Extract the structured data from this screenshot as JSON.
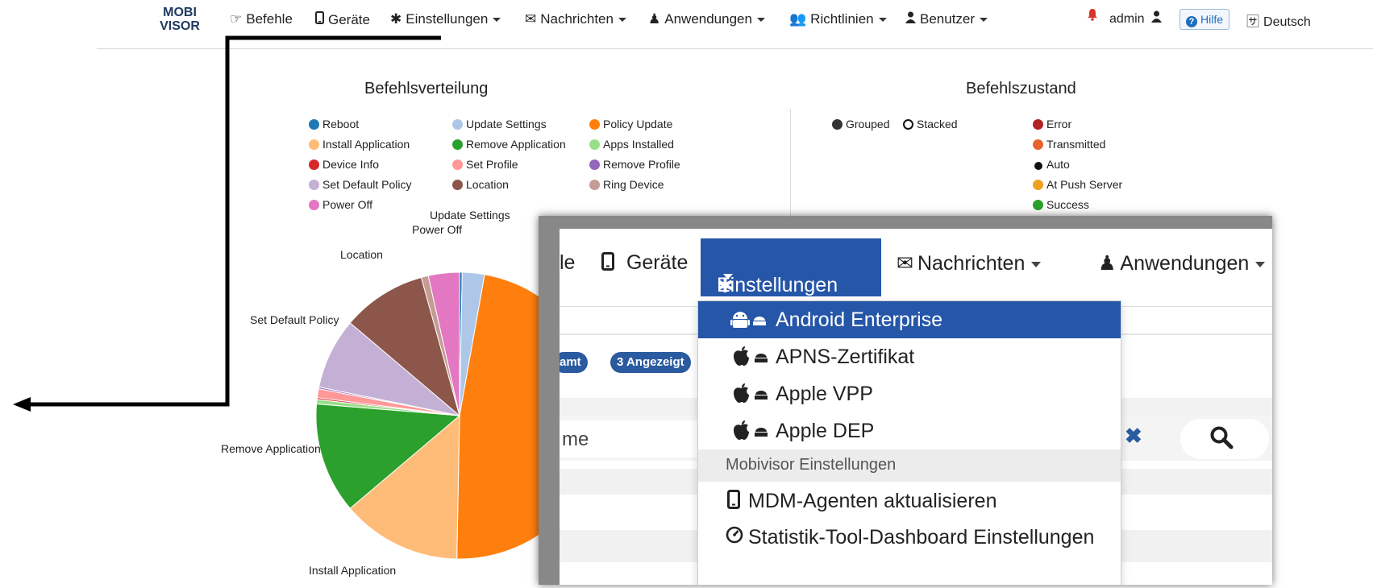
{
  "brand": {
    "line1": "MOBI",
    "line2": "VISOR"
  },
  "nav": {
    "items": [
      {
        "label": "Befehle",
        "icon": "hand-pointer-icon"
      },
      {
        "label": "Geräte",
        "icon": "mobile-icon"
      },
      {
        "label": "Einstellungen",
        "icon": "gear-icon"
      },
      {
        "label": "Nachrichten",
        "icon": "envelope-icon"
      },
      {
        "label": "Anwendungen",
        "icon": "apps-icon"
      },
      {
        "label": "Richtlinien",
        "icon": "users-icon"
      },
      {
        "label": "Benutzer",
        "icon": "user-icon"
      }
    ],
    "user": "admin",
    "help": "Hilfe",
    "language": "Deutsch"
  },
  "left_panel": {
    "title": "Befehlsverteilung",
    "legend": [
      {
        "label": "Reboot",
        "color": "#1f77b4"
      },
      {
        "label": "Update Settings",
        "color": "#aec7e8"
      },
      {
        "label": "Policy Update",
        "color": "#ff7f0e"
      },
      {
        "label": "Install Application",
        "color": "#ffbb78"
      },
      {
        "label": "Remove Application",
        "color": "#2ca02c"
      },
      {
        "label": "Apps Installed",
        "color": "#98df8a"
      },
      {
        "label": "Device Info",
        "color": "#d62728"
      },
      {
        "label": "Set Profile",
        "color": "#ff9896"
      },
      {
        "label": "Remove Profile",
        "color": "#9467bd"
      },
      {
        "label": "Set Default Policy",
        "color": "#c5b0d5"
      },
      {
        "label": "Location",
        "color": "#8c564b"
      },
      {
        "label": "Ring Device",
        "color": "#c49c94"
      },
      {
        "label": "Power Off",
        "color": "#e377c2"
      }
    ],
    "pie_labels": {
      "update_settings": "Update Settings",
      "power_off": "Power Off",
      "location": "Location",
      "set_default_policy": "Set Default Policy",
      "remove_application": "Remove Application",
      "install_application": "Install Application"
    }
  },
  "right_panel": {
    "title": "Befehlszustand",
    "modes": [
      "Grouped",
      "Stacked"
    ],
    "states": [
      {
        "label": "Error",
        "color": "#b22222"
      },
      {
        "label": "Transmitted",
        "color": "#e8622c"
      },
      {
        "label": "Auto",
        "color": "#111111"
      },
      {
        "label": "At Push Server",
        "color": "#f0a020"
      },
      {
        "label": "Success",
        "color": "#2ca02c"
      }
    ]
  },
  "chart_data": {
    "type": "pie",
    "title": "Befehlsverteilung",
    "slices": [
      {
        "label": "Reboot",
        "value": 0.3,
        "color": "#1f77b4"
      },
      {
        "label": "Update Settings",
        "value": 2.5,
        "color": "#aec7e8"
      },
      {
        "label": "Policy Update",
        "value": 47.5,
        "color": "#ff7f0e"
      },
      {
        "label": "Install Application",
        "value": 13.5,
        "color": "#ffbb78"
      },
      {
        "label": "Remove Application",
        "value": 12.5,
        "color": "#2ca02c"
      },
      {
        "label": "Apps Installed",
        "value": 0.5,
        "color": "#98df8a"
      },
      {
        "label": "Device Info",
        "value": 0.2,
        "color": "#d62728"
      },
      {
        "label": "Set Profile",
        "value": 1.0,
        "color": "#ff9896"
      },
      {
        "label": "Remove Profile",
        "value": 0.2,
        "color": "#9467bd"
      },
      {
        "label": "Set Default Policy",
        "value": 8.0,
        "color": "#c5b0d5"
      },
      {
        "label": "Location",
        "value": 9.5,
        "color": "#8c564b"
      },
      {
        "label": "Ring Device",
        "value": 0.8,
        "color": "#c49c94"
      },
      {
        "label": "Power Off",
        "value": 3.5,
        "color": "#e377c2"
      }
    ]
  },
  "inset": {
    "nav": {
      "partial": "le",
      "geraete": "Geräte",
      "einstellungen": "Einstellungen",
      "nachrichten": "Nachrichten",
      "anwendungen": "Anwendungen"
    },
    "badge_total": "amt",
    "badge_shown": "3 Angezeigt",
    "search_partial": "me",
    "dropdown": {
      "items": [
        {
          "label": "Android Enterprise",
          "icon": "android-icon",
          "selected": true
        },
        {
          "label": "APNS-Zertifikat",
          "icon": "apple-icon",
          "selected": false
        },
        {
          "label": "Apple VPP",
          "icon": "apple-icon",
          "selected": false
        },
        {
          "label": "Apple DEP",
          "icon": "apple-icon",
          "selected": false
        }
      ],
      "header": "Mobivisor Einstellungen",
      "extra": [
        {
          "label": "MDM-Agenten aktualisieren",
          "icon": "mobile-icon"
        },
        {
          "label": "Statistik-Tool-Dashboard Einstellungen",
          "icon": "dashboard-icon"
        }
      ]
    }
  }
}
